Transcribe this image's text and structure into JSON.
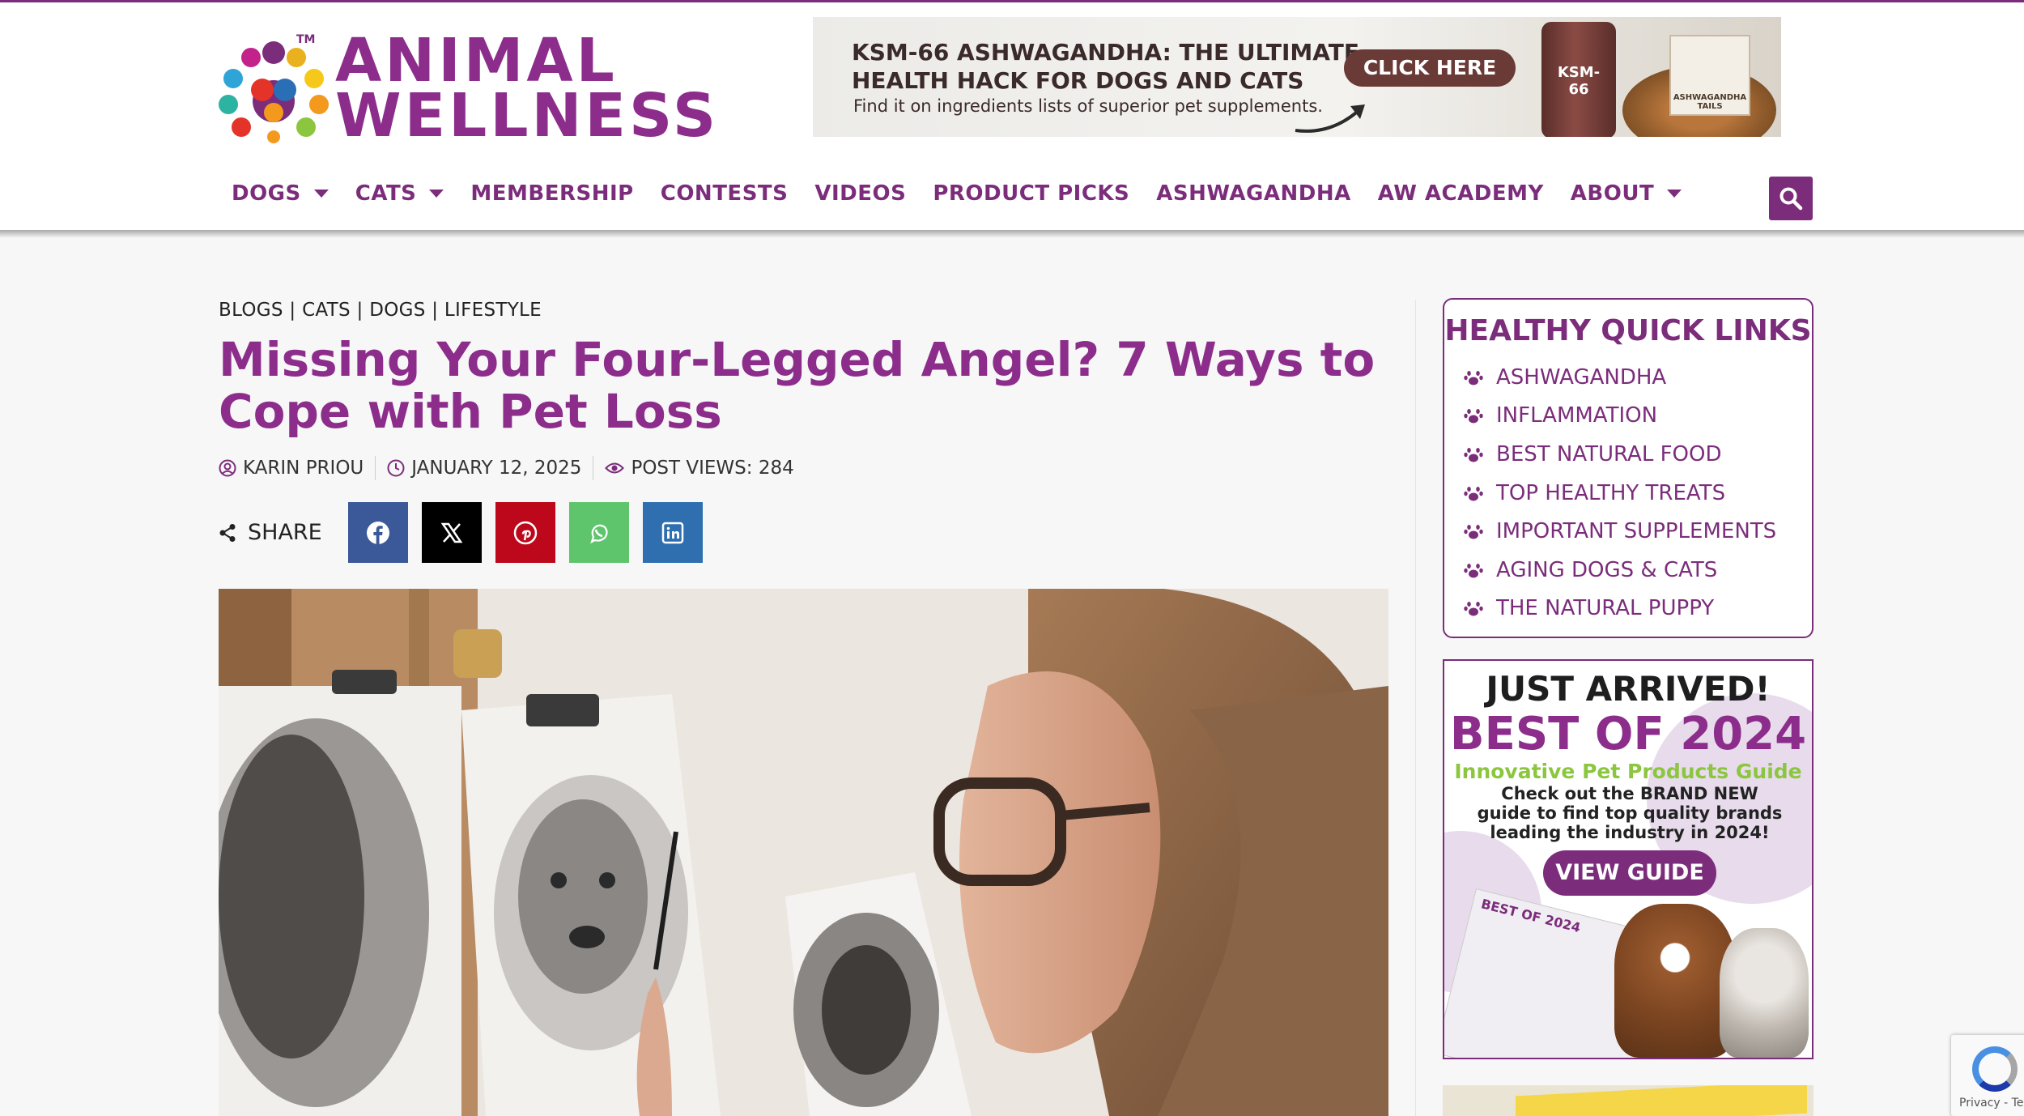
{
  "logo": {
    "line1": "ANIMAL",
    "line2": "WELLNESS",
    "tm": "TM"
  },
  "top_ad": {
    "headline1": "KSM-66 ASHWAGANDHA: THE ULTIMATE",
    "headline2": "HEALTH HACK FOR DOGS AND CATS",
    "subline": "Find it on ingredients lists of superior pet supplements.",
    "button": "CLICK HERE",
    "jar_label": "KSM-66",
    "badge": "ASHWAGANDHA TAILS"
  },
  "nav": {
    "items": [
      {
        "label": "DOGS",
        "has_dropdown": true
      },
      {
        "label": "CATS",
        "has_dropdown": true
      },
      {
        "label": "MEMBERSHIP",
        "has_dropdown": false
      },
      {
        "label": "CONTESTS",
        "has_dropdown": false
      },
      {
        "label": "VIDEOS",
        "has_dropdown": false
      },
      {
        "label": "PRODUCT PICKS",
        "has_dropdown": false
      },
      {
        "label": "ASHWAGANDHA",
        "has_dropdown": false
      },
      {
        "label": "AW ACADEMY",
        "has_dropdown": false
      },
      {
        "label": "ABOUT",
        "has_dropdown": true
      }
    ],
    "search_icon": "search-icon"
  },
  "article": {
    "breadcrumbs": "BLOGS | CATS | DOGS | LIFESTYLE",
    "title": "Missing Your Four-Legged Angel? 7 Ways to Cope with Pet Loss",
    "author": "KARIN PRIOU",
    "date": "JANUARY 12, 2025",
    "views": "POST VIEWS: 284",
    "share_label": "SHARE",
    "share_buttons": [
      {
        "name": "facebook",
        "color": "#3b5998"
      },
      {
        "name": "x",
        "color": "#000000"
      },
      {
        "name": "pinterest",
        "color": "#bd081c"
      },
      {
        "name": "whatsapp",
        "color": "#5fc56d"
      },
      {
        "name": "linkedin",
        "color": "#2f6fb0"
      }
    ]
  },
  "sidebar": {
    "quick_links_title": "HEALTHY QUICK LINKS",
    "quick_links": [
      "ASHWAGANDHA",
      "INFLAMMATION",
      "BEST NATURAL FOOD",
      "TOP HEALTHY TREATS",
      "IMPORTANT SUPPLEMENTS",
      "AGING DOGS & CATS",
      "THE NATURAL PUPPY"
    ],
    "best_ad": {
      "just_arrived": "JUST ARRIVED!",
      "best_of": "BEST OF 2024",
      "subtitle": "Innovative Pet Products Guide",
      "description": "Check out the BRAND NEW guide to find top quality brands leading the industry in 2024!",
      "button": "VIEW GUIDE",
      "magazine_label": "BEST OF 2024"
    }
  },
  "recaptcha": {
    "text": "Privacy - Terms"
  },
  "colors": {
    "brand": "#7b2d7b",
    "title": "#8c2d8c",
    "accent_green": "#8cc63f"
  }
}
